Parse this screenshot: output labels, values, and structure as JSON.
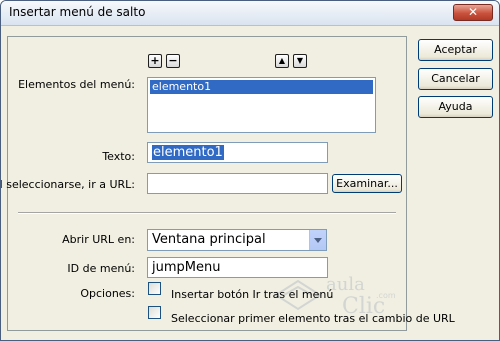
{
  "window": {
    "title": "Insertar menú de salto",
    "close_glyph": "✕"
  },
  "toolbar": {
    "add_glyph": "+",
    "remove_glyph": "−",
    "up_glyph": "▲",
    "down_glyph": "▼"
  },
  "form": {
    "menu_items_label": "Elementos del menú:",
    "menu_items": [
      "elemento1"
    ],
    "text_label": "Texto:",
    "text_value": "elemento1",
    "url_label": "Al seleccionarse, ir a URL:",
    "url_value": "",
    "browse_label": "Examinar...",
    "open_url_label": "Abrir URL en:",
    "open_url_value": "Ventana principal",
    "menu_id_label": "ID de menú:",
    "menu_id_value": "jumpMenu",
    "options_label": "Opciones:",
    "option_go_button": "Insertar botón Ir tras el menú",
    "option_select_first": "Seleccionar primer elemento tras el cambio de URL"
  },
  "buttons": {
    "accept": "Aceptar",
    "cancel": "Cancelar",
    "help": "Ayuda"
  },
  "watermark": {
    "word1": "aula",
    "word2": "Clic",
    "suffix": ".com"
  }
}
